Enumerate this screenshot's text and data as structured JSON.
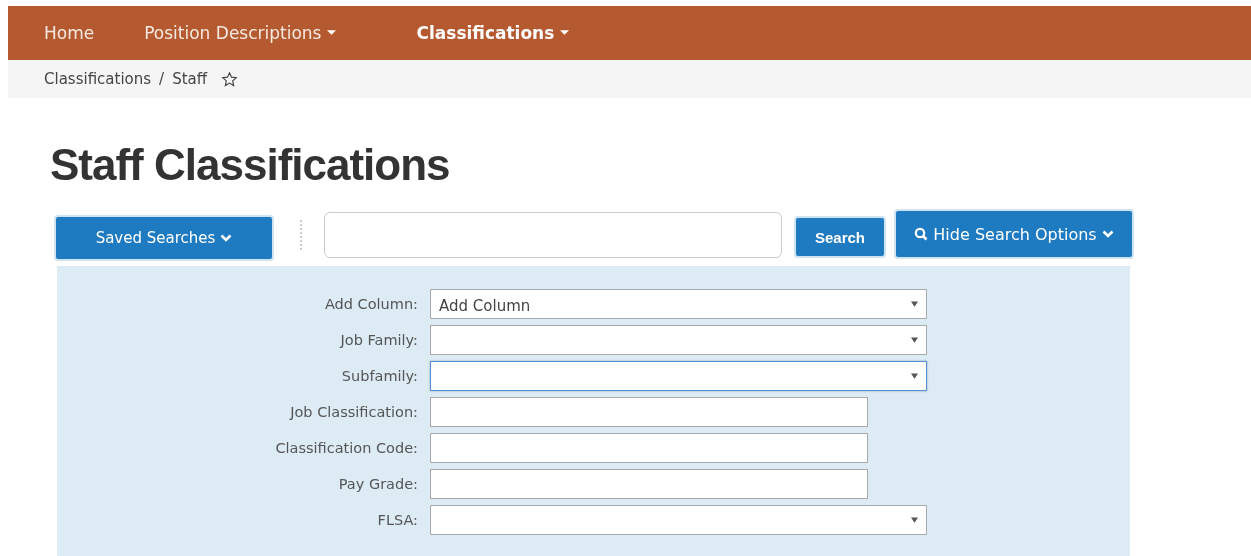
{
  "nav": [
    {
      "label": "Home",
      "selected": false,
      "has_menu": false
    },
    {
      "label": "Position Descriptions",
      "selected": false,
      "has_menu": true
    },
    {
      "label": "Classifications",
      "selected": true,
      "has_menu": true
    }
  ],
  "breadcrumb": {
    "items": [
      "Classifications",
      "Staff"
    ],
    "separator": "/"
  },
  "title": "Staff Classifications",
  "toolbar": {
    "saved_searches": "Saved Searches",
    "search_button": "Search",
    "options_button": "Hide Search Options"
  },
  "fields": [
    {
      "label": "Add Column:",
      "kind": "select",
      "value": "Add Column",
      "focused": false
    },
    {
      "label": "Job Family:",
      "kind": "select",
      "focused": false
    },
    {
      "label": "Subfamily:",
      "kind": "select",
      "focused": true
    },
    {
      "label": "Job Classification:",
      "kind": "text",
      "focused": false
    },
    {
      "label": "Classification Code:",
      "kind": "text",
      "focused": false
    },
    {
      "label": "Pay Grade:",
      "kind": "text",
      "focused": false
    },
    {
      "label": "FLSA:",
      "kind": "select",
      "focused": false
    }
  ]
}
